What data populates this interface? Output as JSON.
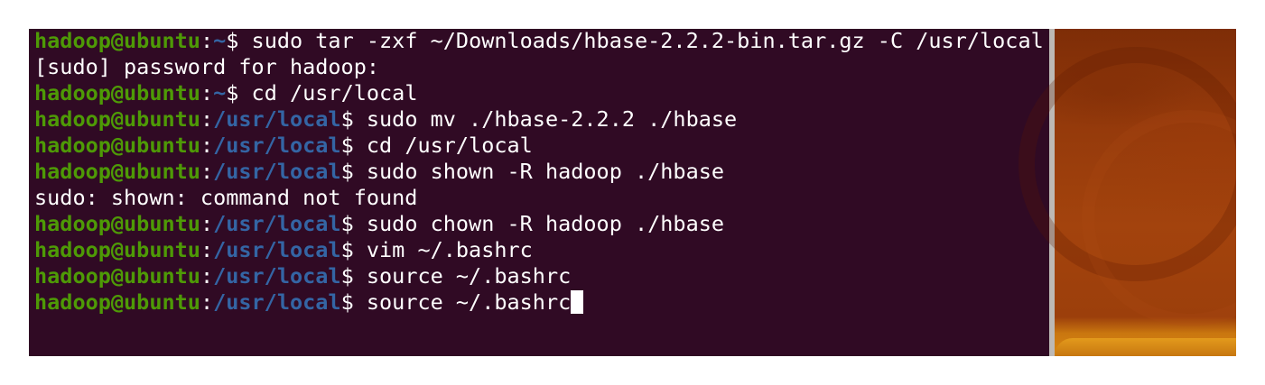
{
  "terminal": {
    "prompt_user": "hadoop@ubuntu",
    "lines": [
      {
        "type": "cmd",
        "dir": "~",
        "command": "sudo tar -zxf ~/Downloads/hbase-2.2.2-bin.tar.gz -C /usr/local"
      },
      {
        "type": "out",
        "text": "[sudo] password for hadoop:"
      },
      {
        "type": "cmd",
        "dir": "~",
        "command": "cd /usr/local"
      },
      {
        "type": "cmd",
        "dir": "/usr/local",
        "command": "sudo mv ./hbase-2.2.2 ./hbase"
      },
      {
        "type": "cmd",
        "dir": "/usr/local",
        "command": "cd /usr/local"
      },
      {
        "type": "cmd",
        "dir": "/usr/local",
        "command": "sudo shown -R hadoop ./hbase"
      },
      {
        "type": "out",
        "text": "sudo: shown: command not found"
      },
      {
        "type": "cmd",
        "dir": "/usr/local",
        "command": "sudo chown -R hadoop ./hbase"
      },
      {
        "type": "cmd",
        "dir": "/usr/local",
        "command": "vim ~/.bashrc"
      },
      {
        "type": "cmd",
        "dir": "/usr/local",
        "command": "source ~/.bashrc"
      },
      {
        "type": "cmd",
        "dir": "/usr/local",
        "command": "source ~/.bashrc",
        "cursor": true
      }
    ]
  },
  "colors": {
    "background": "#300a24",
    "user": "#4e9a06",
    "path": "#3465a4",
    "text": "#ffffff"
  }
}
